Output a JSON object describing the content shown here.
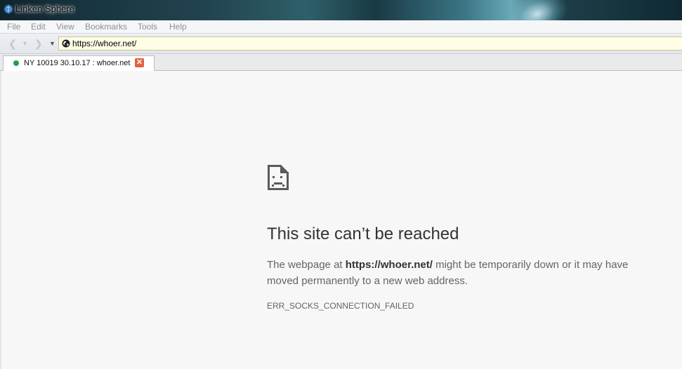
{
  "window": {
    "title": "Linken Sphere"
  },
  "menu": {
    "items": [
      "File",
      "Edit",
      "View",
      "Bookmarks",
      "Tools",
      "Help"
    ]
  },
  "toolbar": {
    "url": "https://whoer.net/"
  },
  "tabs": [
    {
      "label": "NY 10019 30.10.17 : whoer.net",
      "status_color": "#1fa04a"
    }
  ],
  "error": {
    "title": "This site can’t be reached",
    "desc_prefix": "The webpage at ",
    "desc_url": "https://whoer.net/",
    "desc_suffix": " might be temporarily down or it may have moved permanently to a new web address.",
    "code": "ERR_SOCKS_CONNECTION_FAILED"
  }
}
